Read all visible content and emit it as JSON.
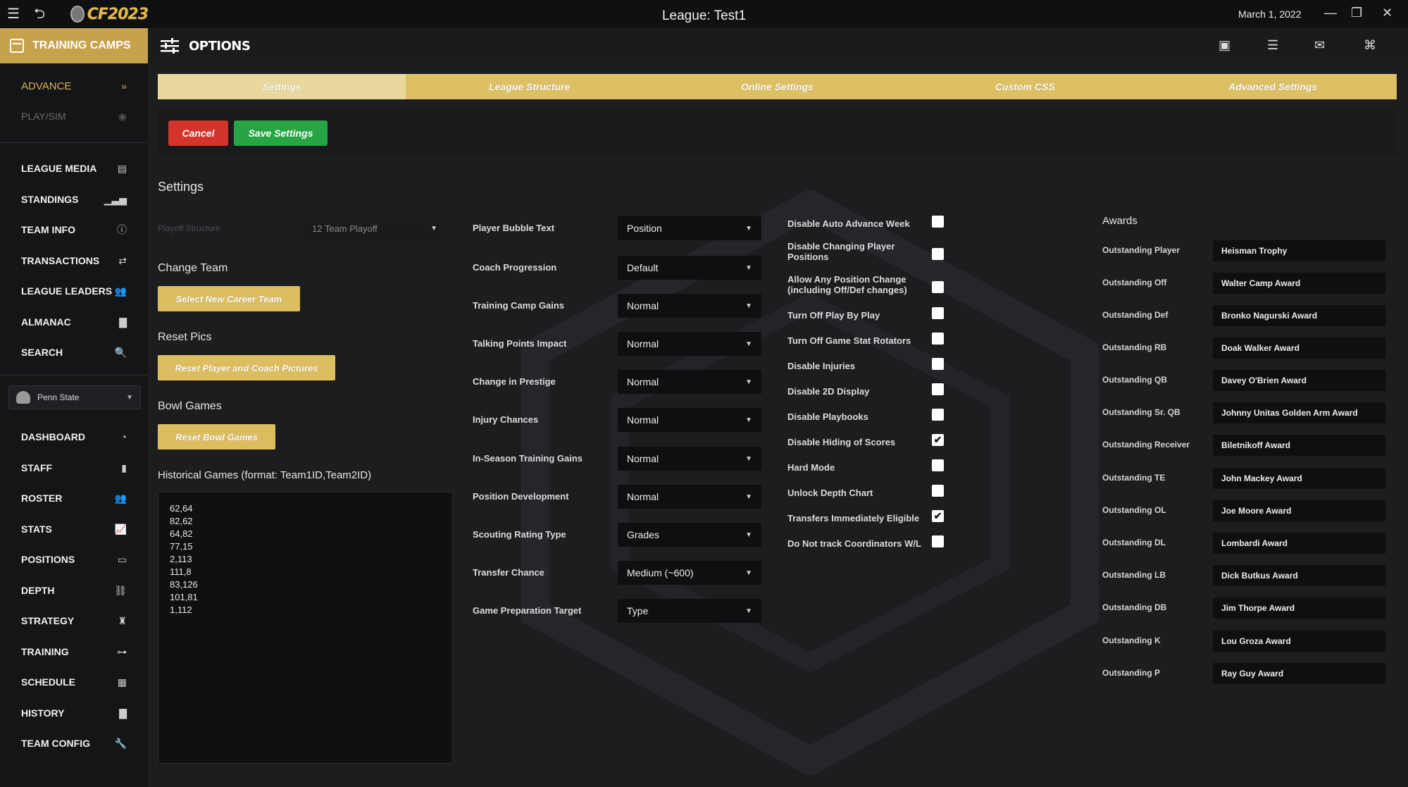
{
  "window": {
    "logo_text": "CF2023",
    "title": "League: Test1",
    "date": "March 1, 2022"
  },
  "header": {
    "training_camps_label": "TRAINING CAMPS",
    "options_label": "OPTIONS"
  },
  "sidebar": {
    "advance": "ADVANCE",
    "play_sim": "PLAY/SIM",
    "league_items": [
      "LEAGUE MEDIA",
      "STANDINGS",
      "TEAM INFO",
      "TRANSACTIONS",
      "LEAGUE LEADERS",
      "ALMANAC",
      "SEARCH"
    ],
    "team_selector": "Penn State",
    "team_items": [
      "DASHBOARD",
      "STAFF",
      "ROSTER",
      "STATS",
      "POSITIONS",
      "DEPTH",
      "STRATEGY",
      "TRAINING",
      "SCHEDULE",
      "HISTORY",
      "TEAM CONFIG"
    ]
  },
  "tabs": [
    "Settings",
    "League Structure",
    "Online Settings",
    "Custom CSS",
    "Advanced Settings"
  ],
  "actions": {
    "cancel": "Cancel",
    "save": "Save Settings"
  },
  "settings": {
    "heading": "Settings",
    "playoff_label": "Playoff Structure",
    "playoff_value": "12 Team Playoff",
    "change_team_heading": "Change Team",
    "change_team_button": "Select New Career Team",
    "reset_pics_heading": "Reset Pics",
    "reset_pics_button": "Reset Player and Coach Pictures",
    "bowl_games_heading": "Bowl Games",
    "bowl_games_button": "Reset Bowl Games",
    "historical_heading": "Historical Games (format: Team1ID,Team2ID)",
    "historical_text": "62,64\n82,62\n64,82\n77,15\n2,113\n111,8\n83,126\n101,81\n1,112"
  },
  "dropdowns": [
    {
      "label": "Player Bubble Text",
      "value": "Position"
    },
    {
      "label": "Coach Progression",
      "value": "Default"
    },
    {
      "label": "Training Camp Gains",
      "value": "Normal"
    },
    {
      "label": "Talking Points Impact",
      "value": "Normal"
    },
    {
      "label": "Change in Prestige",
      "value": "Normal"
    },
    {
      "label": "Injury Chances",
      "value": "Normal"
    },
    {
      "label": "In-Season Training Gains",
      "value": "Normal"
    },
    {
      "label": "Position Development",
      "value": "Normal"
    },
    {
      "label": "Scouting Rating Type",
      "value": "Grades"
    },
    {
      "label": "Transfer Chance",
      "value": "Medium (~600)"
    },
    {
      "label": "Game Preparation Target",
      "value": "Type"
    }
  ],
  "checkboxes": [
    {
      "label": "Disable Auto Advance Week",
      "checked": false
    },
    {
      "label": "Disable Changing Player Positions",
      "checked": false
    },
    {
      "label": "Allow Any Position Change (including Off/Def changes)",
      "checked": false
    },
    {
      "label": "Turn Off Play By Play",
      "checked": false
    },
    {
      "label": "Turn Off Game Stat Rotators",
      "checked": false
    },
    {
      "label": "Disable Injuries",
      "checked": false
    },
    {
      "label": "Disable 2D Display",
      "checked": false
    },
    {
      "label": "Disable Playbooks",
      "checked": false
    },
    {
      "label": "Disable Hiding of Scores",
      "checked": true
    },
    {
      "label": "Hard Mode",
      "checked": false
    },
    {
      "label": "Unlock Depth Chart",
      "checked": false
    },
    {
      "label": "Transfers Immediately Eligible",
      "checked": true
    },
    {
      "label": "Do Not track Coordinators W/L",
      "checked": false
    }
  ],
  "awards": {
    "heading": "Awards",
    "items": [
      {
        "label": "Outstanding Player",
        "value": "Heisman Trophy"
      },
      {
        "label": "Outstanding Off",
        "value": "Walter Camp Award"
      },
      {
        "label": "Outstanding Def",
        "value": "Bronko Nagurski Award"
      },
      {
        "label": "Outstanding RB",
        "value": "Doak Walker Award"
      },
      {
        "label": "Outstanding QB",
        "value": "Davey O'Brien Award"
      },
      {
        "label": "Outstanding Sr. QB",
        "value": "Johnny Unitas Golden Arm Award"
      },
      {
        "label": "Outstanding Receiver",
        "value": "Biletnikoff Award"
      },
      {
        "label": "Outstanding TE",
        "value": "John Mackey Award"
      },
      {
        "label": "Outstanding OL",
        "value": "Joe Moore Award"
      },
      {
        "label": "Outstanding DL",
        "value": "Lombardi Award"
      },
      {
        "label": "Outstanding LB",
        "value": "Dick Butkus Award"
      },
      {
        "label": "Outstanding DB",
        "value": "Jim Thorpe Award"
      },
      {
        "label": "Outstanding K",
        "value": "Lou Groza Award"
      },
      {
        "label": "Outstanding P",
        "value": "Ray Guy Award"
      }
    ]
  },
  "colors": {
    "accent_gold": "#ddbf64",
    "cancel_red": "#d4342c",
    "save_green": "#27a544"
  }
}
